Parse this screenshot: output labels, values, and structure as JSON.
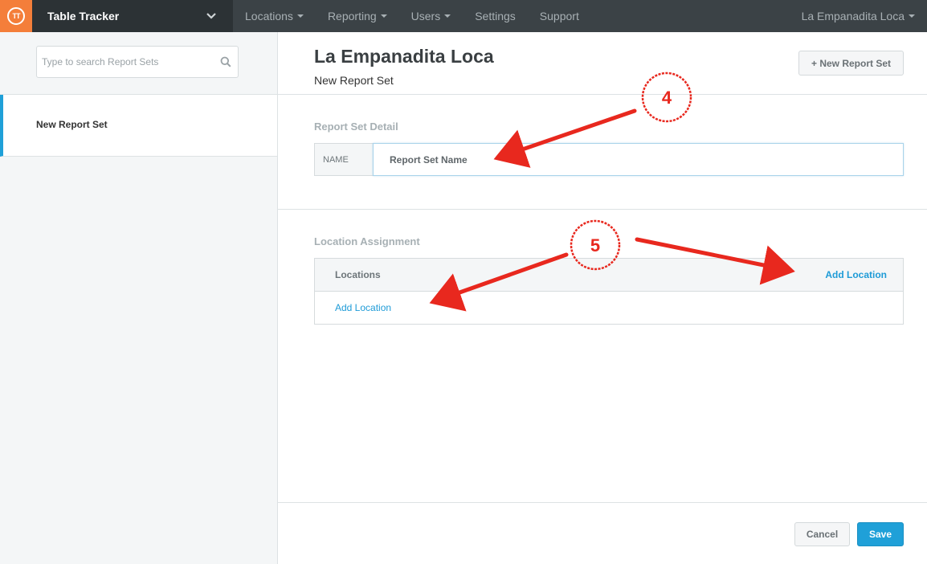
{
  "app": {
    "logo_text": "TT",
    "title": "Table Tracker",
    "brand_color": "#f47e3a",
    "accent_color": "#1fa0d8"
  },
  "nav": {
    "items": [
      {
        "label": "Locations",
        "has_caret": true
      },
      {
        "label": "Reporting",
        "has_caret": true
      },
      {
        "label": "Users",
        "has_caret": true
      },
      {
        "label": "Settings",
        "has_caret": false
      },
      {
        "label": "Support",
        "has_caret": false
      }
    ],
    "account_label": "La Empanadita Loca"
  },
  "sidebar": {
    "search_placeholder": "Type to search Report Sets",
    "items": [
      {
        "label": "New Report Set",
        "active": true
      }
    ]
  },
  "main": {
    "title": "La Empanadita Loca",
    "subtitle": "New Report Set",
    "new_button_label": "+ New Report Set",
    "detail_section": {
      "title": "Report Set Detail",
      "name_label": "NAME",
      "name_placeholder": "Report Set Name",
      "name_value": ""
    },
    "location_section": {
      "title": "Location Assignment",
      "column_label": "Locations",
      "header_add_link": "Add Location",
      "body_add_link": "Add Location"
    },
    "cancel_label": "Cancel",
    "save_label": "Save"
  },
  "annotations": {
    "color": "#e8281e",
    "badges": [
      "4",
      "5"
    ]
  }
}
